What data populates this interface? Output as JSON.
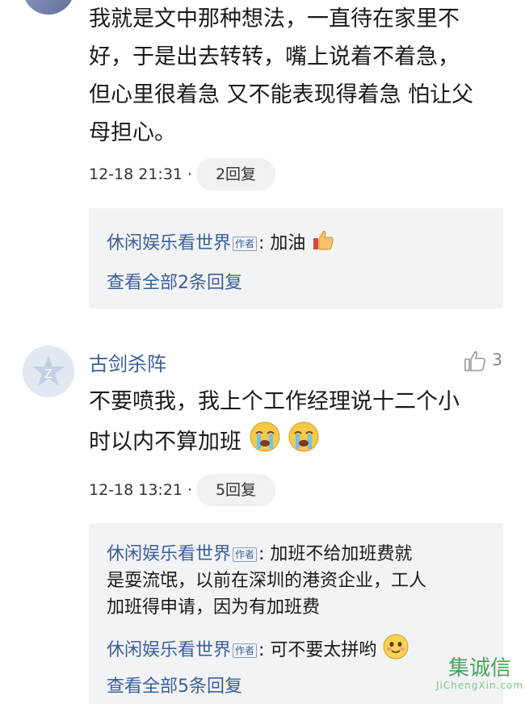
{
  "comment1": {
    "text_lines": [
      "我就是文中那种想法，一直待在家里不",
      "好，于是出去转转，嘴上说着不着急，",
      "但心里很着急 又不能表现得着急 怕让父",
      "母担心。"
    ],
    "time": "12-18 21:31 ·",
    "reply_count": "2回复",
    "replies": [
      {
        "name": "休闲娱乐看世界",
        "tag": "作者",
        "text": ": 加油"
      }
    ],
    "view_all": "查看全部2条回复"
  },
  "comment2": {
    "user": "古剑杀阵",
    "likes": "3",
    "text_lines": [
      "不要喷我，我上个工作经理说十二个小",
      "时以内不算加班"
    ],
    "time": "12-18 13:21 ·",
    "reply_count": "5回复",
    "replies": [
      {
        "name": "休闲娱乐看世界",
        "tag": "作者",
        "text_lines": [
          ": 加班不给加班费就",
          "是耍流氓，以前在深圳的港资企业，工人",
          "加班得申请，因为有加班费"
        ]
      },
      {
        "name": "休闲娱乐看世界",
        "tag": "作者",
        "text": ": 可不要太拼哟"
      }
    ],
    "view_all": "查看全部5条回复"
  },
  "watermark": {
    "text": "集诚信",
    "sub": "JiChengXin.com"
  },
  "colors": {
    "link": "#3b5f9a",
    "reply_bg": "#f2f3f5",
    "pill_bg": "#f0f1f3"
  }
}
